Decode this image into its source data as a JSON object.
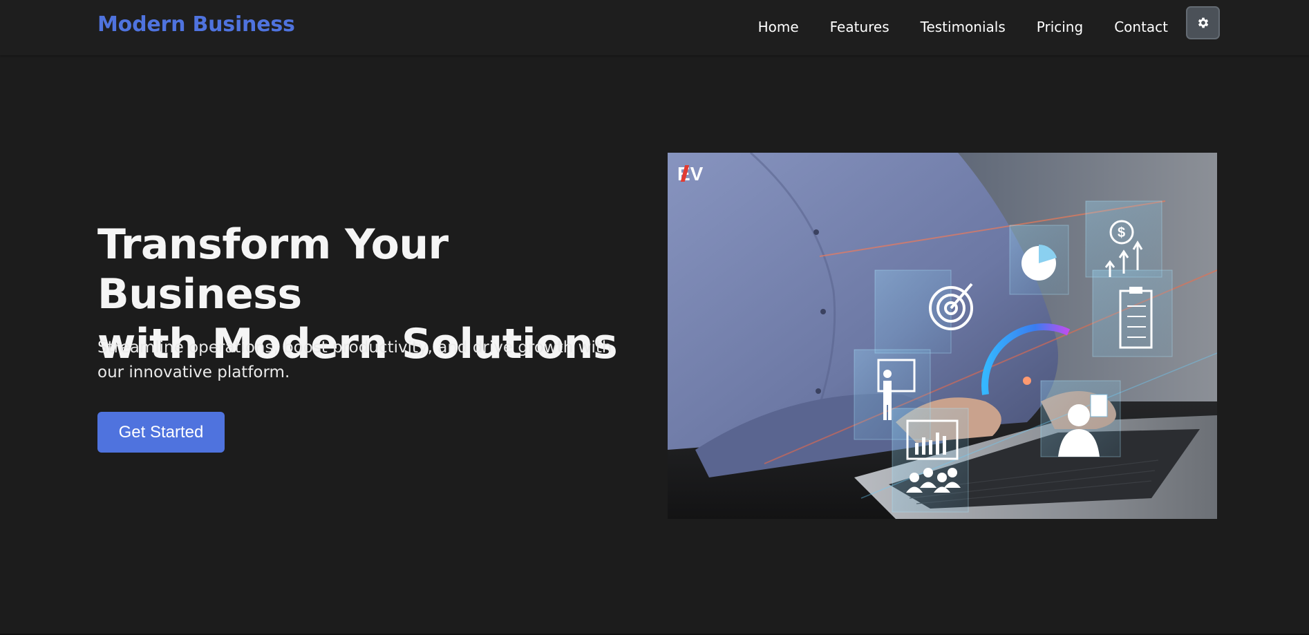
{
  "brand": {
    "name": "Modern Business",
    "color": "#4f73de"
  },
  "nav": {
    "links": [
      {
        "label": "Home"
      },
      {
        "label": "Features"
      },
      {
        "label": "Testimonials"
      },
      {
        "label": "Pricing"
      },
      {
        "label": "Contact"
      }
    ],
    "theme_toggle_icon": "gear-icon"
  },
  "hero": {
    "title_line1": "Transform Your Business",
    "title_line2": "with Modern Solutions",
    "subtitle": "Streamline operations, boost productivity, and drive growth with our innovative platform.",
    "cta_label": "Get Started",
    "image": {
      "logo_text": "EV"
    }
  },
  "colors": {
    "background": "#1c1c1c",
    "navbar": "#1e1e1e",
    "accent": "#4f73de",
    "text": "#f5f5f5"
  }
}
